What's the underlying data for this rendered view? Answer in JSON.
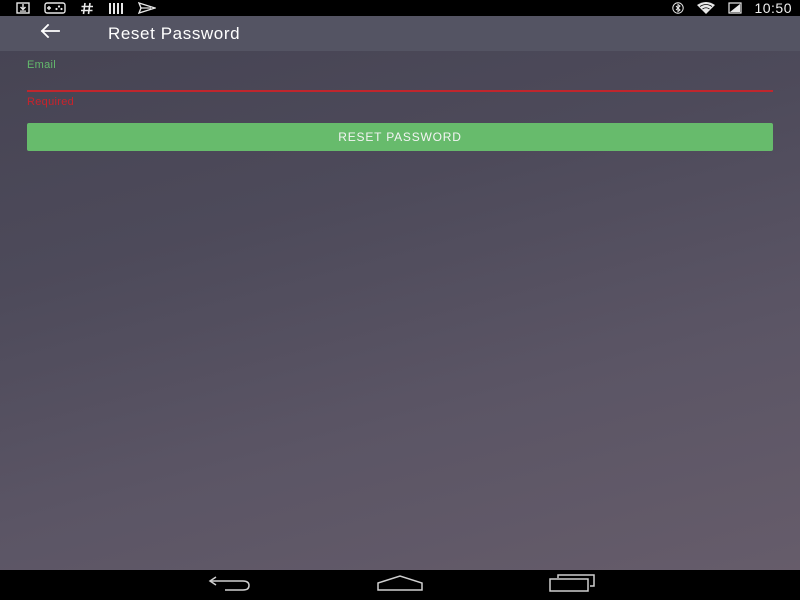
{
  "status_bar": {
    "time": "10:50",
    "left_icons": [
      "download-icon",
      "game-controller-icon",
      "hashtag-icon",
      "barcode-icon",
      "paper-plane-icon"
    ],
    "right_icons": [
      "bluetooth-icon",
      "wifi-icon",
      "battery-icon"
    ]
  },
  "app_bar": {
    "title": "Reset Password",
    "back_icon": "arrow-left-icon"
  },
  "form": {
    "email_label": "Email",
    "email_value": "",
    "email_error": "Required",
    "submit_label": "RESET PASSWORD"
  },
  "nav_bar": {
    "icons": [
      "nav-back-icon",
      "nav-home-icon",
      "nav-recents-icon"
    ]
  },
  "colors": {
    "accent_green": "#67bb6c",
    "error_red": "#c0262d",
    "app_bar": "#545463",
    "background_top": "#454352",
    "background_bottom": "#675d6b"
  }
}
